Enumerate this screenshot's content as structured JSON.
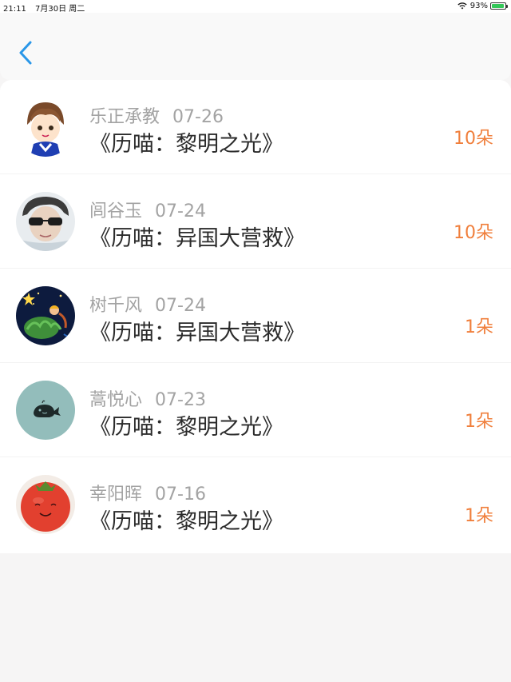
{
  "status_bar": {
    "time": "21:11",
    "date": "7月30日 周二",
    "battery_percent": "93%",
    "battery_level": 0.93,
    "battery_color": "#34c759"
  },
  "nav": {
    "back_icon": "chevron-left-icon",
    "accent_color": "#2a97e8"
  },
  "records": [
    {
      "name": "乐正承教",
      "date": "07-26",
      "title": "《历喵：黎明之光》",
      "amount": "10朵"
    },
    {
      "name": "闾谷玉",
      "date": "07-24",
      "title": "《历喵：异国大营救》",
      "amount": "10朵"
    },
    {
      "name": "树千风",
      "date": "07-24",
      "title": "《历喵：异国大营救》",
      "amount": "1朵"
    },
    {
      "name": "蒿悦心",
      "date": "07-23",
      "title": "《历喵：黎明之光》",
      "amount": "1朵"
    },
    {
      "name": "幸阳晖",
      "date": "07-16",
      "title": "《历喵：黎明之光》",
      "amount": "1朵"
    }
  ],
  "colors": {
    "amount": "#f07f3c",
    "meta": "#a3a3a3",
    "title": "#2b2b2b",
    "background": "#f6f5f5"
  }
}
